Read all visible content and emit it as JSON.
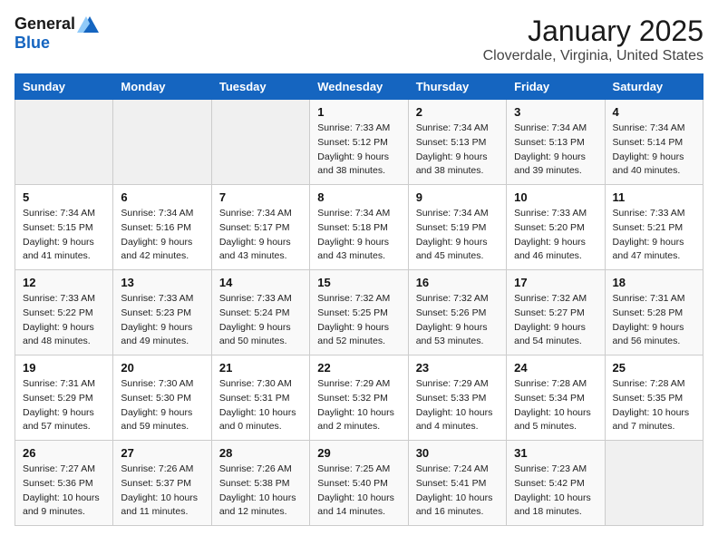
{
  "header": {
    "logo_general": "General",
    "logo_blue": "Blue",
    "month": "January 2025",
    "location": "Cloverdale, Virginia, United States"
  },
  "weekdays": [
    "Sunday",
    "Monday",
    "Tuesday",
    "Wednesday",
    "Thursday",
    "Friday",
    "Saturday"
  ],
  "weeks": [
    [
      {
        "day": "",
        "info": ""
      },
      {
        "day": "",
        "info": ""
      },
      {
        "day": "",
        "info": ""
      },
      {
        "day": "1",
        "info": "Sunrise: 7:33 AM\nSunset: 5:12 PM\nDaylight: 9 hours\nand 38 minutes."
      },
      {
        "day": "2",
        "info": "Sunrise: 7:34 AM\nSunset: 5:13 PM\nDaylight: 9 hours\nand 38 minutes."
      },
      {
        "day": "3",
        "info": "Sunrise: 7:34 AM\nSunset: 5:13 PM\nDaylight: 9 hours\nand 39 minutes."
      },
      {
        "day": "4",
        "info": "Sunrise: 7:34 AM\nSunset: 5:14 PM\nDaylight: 9 hours\nand 40 minutes."
      }
    ],
    [
      {
        "day": "5",
        "info": "Sunrise: 7:34 AM\nSunset: 5:15 PM\nDaylight: 9 hours\nand 41 minutes."
      },
      {
        "day": "6",
        "info": "Sunrise: 7:34 AM\nSunset: 5:16 PM\nDaylight: 9 hours\nand 42 minutes."
      },
      {
        "day": "7",
        "info": "Sunrise: 7:34 AM\nSunset: 5:17 PM\nDaylight: 9 hours\nand 43 minutes."
      },
      {
        "day": "8",
        "info": "Sunrise: 7:34 AM\nSunset: 5:18 PM\nDaylight: 9 hours\nand 43 minutes."
      },
      {
        "day": "9",
        "info": "Sunrise: 7:34 AM\nSunset: 5:19 PM\nDaylight: 9 hours\nand 45 minutes."
      },
      {
        "day": "10",
        "info": "Sunrise: 7:33 AM\nSunset: 5:20 PM\nDaylight: 9 hours\nand 46 minutes."
      },
      {
        "day": "11",
        "info": "Sunrise: 7:33 AM\nSunset: 5:21 PM\nDaylight: 9 hours\nand 47 minutes."
      }
    ],
    [
      {
        "day": "12",
        "info": "Sunrise: 7:33 AM\nSunset: 5:22 PM\nDaylight: 9 hours\nand 48 minutes."
      },
      {
        "day": "13",
        "info": "Sunrise: 7:33 AM\nSunset: 5:23 PM\nDaylight: 9 hours\nand 49 minutes."
      },
      {
        "day": "14",
        "info": "Sunrise: 7:33 AM\nSunset: 5:24 PM\nDaylight: 9 hours\nand 50 minutes."
      },
      {
        "day": "15",
        "info": "Sunrise: 7:32 AM\nSunset: 5:25 PM\nDaylight: 9 hours\nand 52 minutes."
      },
      {
        "day": "16",
        "info": "Sunrise: 7:32 AM\nSunset: 5:26 PM\nDaylight: 9 hours\nand 53 minutes."
      },
      {
        "day": "17",
        "info": "Sunrise: 7:32 AM\nSunset: 5:27 PM\nDaylight: 9 hours\nand 54 minutes."
      },
      {
        "day": "18",
        "info": "Sunrise: 7:31 AM\nSunset: 5:28 PM\nDaylight: 9 hours\nand 56 minutes."
      }
    ],
    [
      {
        "day": "19",
        "info": "Sunrise: 7:31 AM\nSunset: 5:29 PM\nDaylight: 9 hours\nand 57 minutes."
      },
      {
        "day": "20",
        "info": "Sunrise: 7:30 AM\nSunset: 5:30 PM\nDaylight: 9 hours\nand 59 minutes."
      },
      {
        "day": "21",
        "info": "Sunrise: 7:30 AM\nSunset: 5:31 PM\nDaylight: 10 hours\nand 0 minutes."
      },
      {
        "day": "22",
        "info": "Sunrise: 7:29 AM\nSunset: 5:32 PM\nDaylight: 10 hours\nand 2 minutes."
      },
      {
        "day": "23",
        "info": "Sunrise: 7:29 AM\nSunset: 5:33 PM\nDaylight: 10 hours\nand 4 minutes."
      },
      {
        "day": "24",
        "info": "Sunrise: 7:28 AM\nSunset: 5:34 PM\nDaylight: 10 hours\nand 5 minutes."
      },
      {
        "day": "25",
        "info": "Sunrise: 7:28 AM\nSunset: 5:35 PM\nDaylight: 10 hours\nand 7 minutes."
      }
    ],
    [
      {
        "day": "26",
        "info": "Sunrise: 7:27 AM\nSunset: 5:36 PM\nDaylight: 10 hours\nand 9 minutes."
      },
      {
        "day": "27",
        "info": "Sunrise: 7:26 AM\nSunset: 5:37 PM\nDaylight: 10 hours\nand 11 minutes."
      },
      {
        "day": "28",
        "info": "Sunrise: 7:26 AM\nSunset: 5:38 PM\nDaylight: 10 hours\nand 12 minutes."
      },
      {
        "day": "29",
        "info": "Sunrise: 7:25 AM\nSunset: 5:40 PM\nDaylight: 10 hours\nand 14 minutes."
      },
      {
        "day": "30",
        "info": "Sunrise: 7:24 AM\nSunset: 5:41 PM\nDaylight: 10 hours\nand 16 minutes."
      },
      {
        "day": "31",
        "info": "Sunrise: 7:23 AM\nSunset: 5:42 PM\nDaylight: 10 hours\nand 18 minutes."
      },
      {
        "day": "",
        "info": ""
      }
    ]
  ]
}
